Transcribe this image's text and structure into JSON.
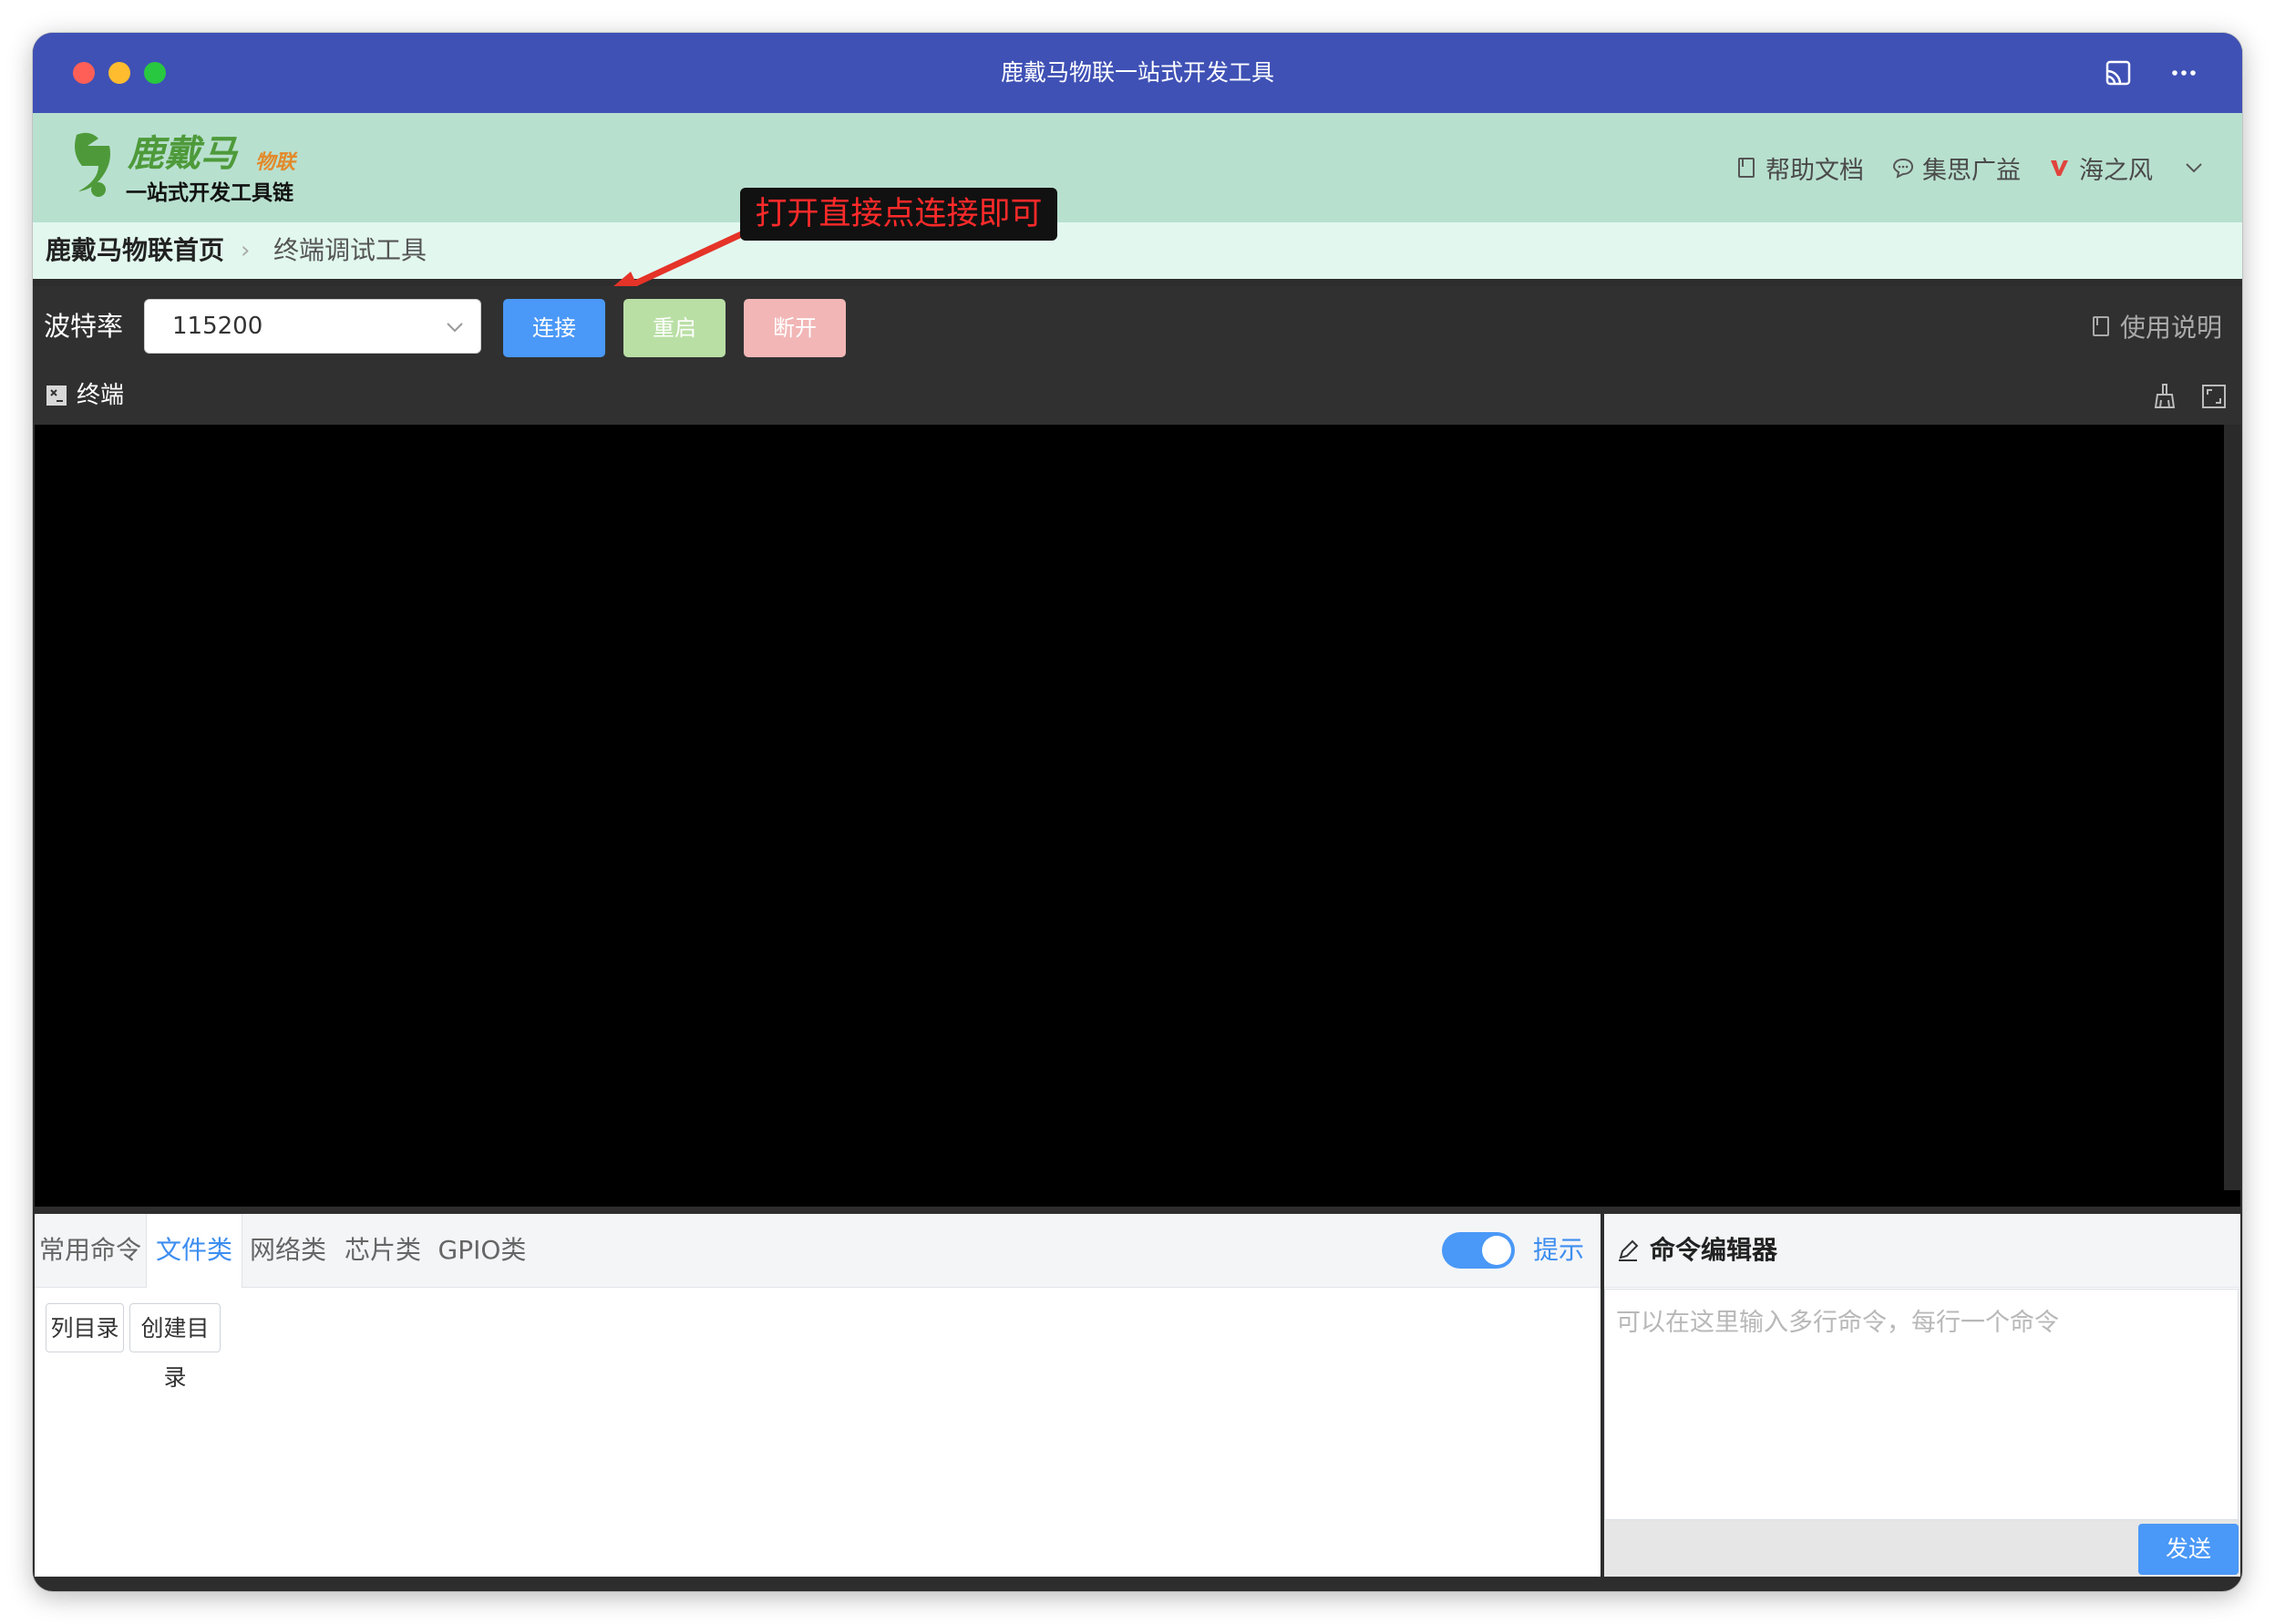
{
  "window": {
    "title": "鹿戴马物联一站式开发工具"
  },
  "header": {
    "logo_main": "鹿戴马",
    "logo_sub": "物联",
    "logo_tagline": "一站式开发工具链",
    "links": [
      {
        "label": "帮助文档",
        "icon": "book-icon"
      },
      {
        "label": "集思广益",
        "icon": "chat-icon"
      },
      {
        "label": "海之风",
        "icon": "vip-icon"
      }
    ]
  },
  "breadcrumb": {
    "home": "鹿戴马物联首页",
    "current": "终端调试工具"
  },
  "annotation": {
    "text": "打开直接点连接即可"
  },
  "toolbar": {
    "baud_label": "波特率",
    "baud_value": "115200",
    "connect_label": "连接",
    "restart_label": "重启",
    "disconnect_label": "断开",
    "usage_label": "使用说明"
  },
  "terminal": {
    "title": "终端"
  },
  "commands": {
    "tabs": [
      "常用命令",
      "文件类",
      "网络类",
      "芯片类",
      "GPIO类"
    ],
    "active_tab": "文件类",
    "hint_label": "提示",
    "hint_enabled": true,
    "buttons": [
      "列目录",
      "创建目录"
    ]
  },
  "editor": {
    "title": "命令编辑器",
    "placeholder": "可以在这里输入多行命令，每行一个命令",
    "send_label": "发送"
  },
  "colors": {
    "titlebar": "#3f51b5",
    "header": "#b8e0cf",
    "accent": "#4a98f7",
    "logo_green": "#4e9a3a",
    "logo_orange": "#e3892a"
  }
}
